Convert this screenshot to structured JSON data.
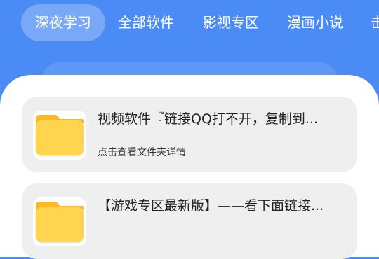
{
  "tabs": [
    {
      "label": "深夜学习",
      "active": true
    },
    {
      "label": "全部软件",
      "active": false
    },
    {
      "label": "影视专区",
      "active": false
    },
    {
      "label": "漫画小说",
      "active": false
    },
    {
      "label": "击",
      "active": false
    }
  ],
  "cards": [
    {
      "title": "视频软件『链接QQ打不开，复制到...",
      "subtitle": "点击查看文件夹详情",
      "icon": "folder-icon"
    },
    {
      "title": "【游戏专区最新版】——看下面链接...",
      "subtitle": "",
      "icon": "folder-icon"
    }
  ],
  "colors": {
    "header_background": "#4B8BF5",
    "card_background": "#EFEFEF",
    "folder_yellow": "#FFD54F",
    "folder_orange": "#FFB72A"
  }
}
